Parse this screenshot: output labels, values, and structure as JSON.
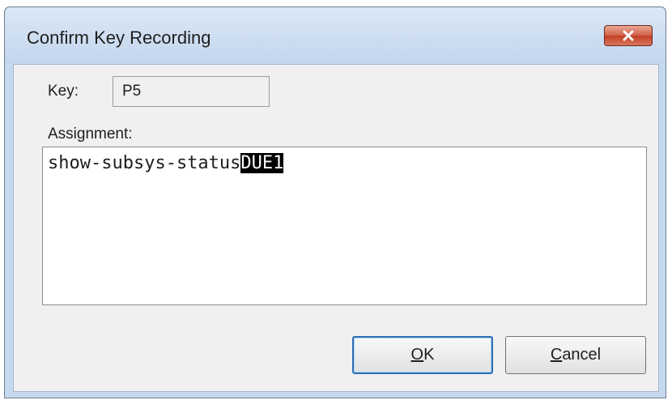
{
  "window": {
    "title": "Confirm Key Recording"
  },
  "key": {
    "label": "Key:",
    "value": "P5"
  },
  "assignment": {
    "label": "Assignment:",
    "text_before_selection": "show-subsys-status",
    "selected_text": "DUE1"
  },
  "buttons": {
    "ok_mnemonic": "O",
    "ok_rest": "K",
    "cancel_mnemonic": "C",
    "cancel_rest": "ancel"
  },
  "icons": {
    "close": "close-icon"
  }
}
